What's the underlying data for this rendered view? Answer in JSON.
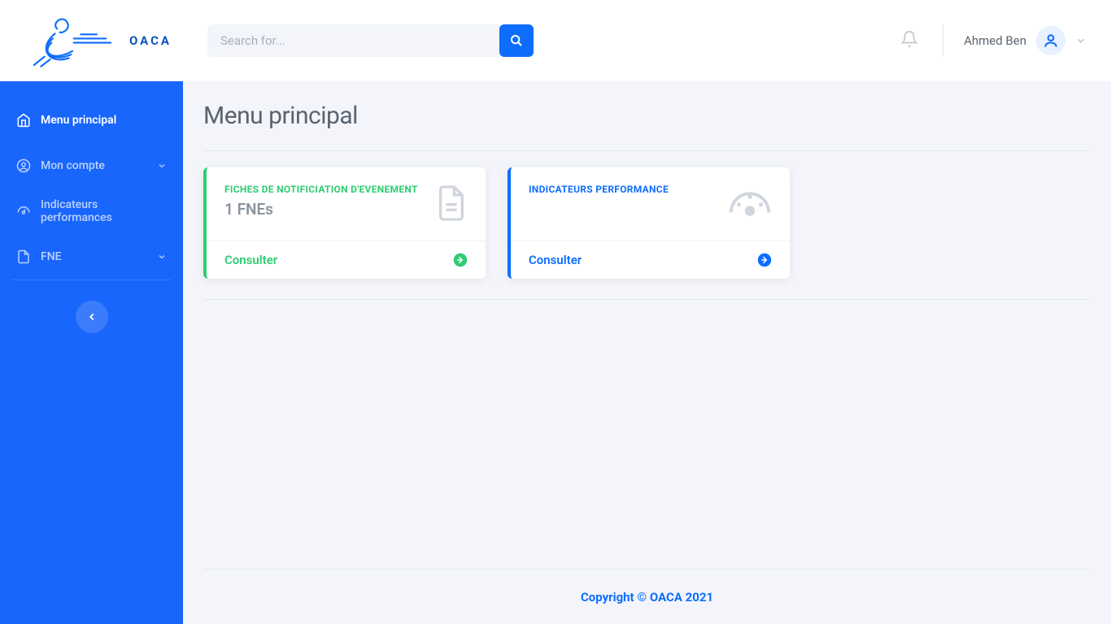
{
  "brand": "OACA",
  "search": {
    "placeholder": "Search for..."
  },
  "user": {
    "name": "Ahmed Ben"
  },
  "sidebar": {
    "items": [
      {
        "label": "Menu principal",
        "active": true,
        "expandable": false
      },
      {
        "label": "Mon compte",
        "active": false,
        "expandable": true
      },
      {
        "label": "Indicateurs performances",
        "active": false,
        "expandable": false
      },
      {
        "label": "FNE",
        "active": false,
        "expandable": true
      }
    ]
  },
  "page": {
    "title": "Menu principal"
  },
  "cards": [
    {
      "title": "FICHES DE NOTIFICIATION D'EVENEMENT",
      "value": "1 FNEs",
      "action": "Consulter",
      "color": "green"
    },
    {
      "title": "INDICATEURS PERFORMANCE",
      "value": "",
      "action": "Consulter",
      "color": "blue"
    }
  ],
  "footer": "Copyright © OACA 2021"
}
